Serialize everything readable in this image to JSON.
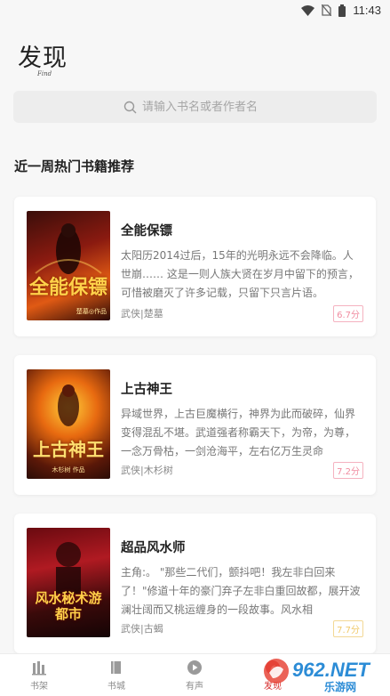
{
  "status": {
    "time": "11:43",
    "icons": [
      "wifi-icon",
      "no-sim-icon",
      "battery-icon"
    ]
  },
  "header": {
    "title": "发现",
    "subtitle": "Find"
  },
  "search": {
    "placeholder": "请输入书名或者作者名",
    "icon": "search-icon"
  },
  "section": {
    "title": "近一周热门书籍推荐"
  },
  "books": [
    {
      "title": "全能保镖",
      "description": "太阳历2014过后，15年的光明永远不会降临。人世崩…… 这是一则人族大贤在岁月中留下的预言，可惜被磨灭了许多记载，只留下只言片语。",
      "meta": "武侠|楚墓",
      "score": "6.7分",
      "score_color": "#f08ca0",
      "cover": {
        "text": "全能保镖",
        "author_line": "楚墓◎作品"
      }
    },
    {
      "title": "上古神王",
      "description": "异域世界，上古巨魔横行，神界为此而破碎，仙界变得混乱不堪。武道强者称霸天下，为帝，为尊，一念万骨枯，一剑沧海平，左右亿万生灵命",
      "meta": "武侠|木杉树",
      "score": "7.2分",
      "score_color": "#f08ca0",
      "cover": {
        "text": "上古神王",
        "author_line": "木杉树 作品"
      }
    },
    {
      "title": "超品风水师",
      "description": "主角:。 \"那些二代们，颤抖吧！我左非白回来了！\"修道十年的豪门弃子左非白重回故都，展开波澜壮阔而又桃运缠身的一段故事。风水相",
      "meta": "武侠|古蝎",
      "score": "7.7分",
      "score_color": "#f0c96a",
      "cover": {
        "text": "风水秘术游都市"
      }
    }
  ],
  "tabs": [
    {
      "label": "书架",
      "icon": "bookshelf-icon"
    },
    {
      "label": "书城",
      "icon": "book-city-icon"
    },
    {
      "label": "有声",
      "icon": "play-icon"
    },
    {
      "label": "发现",
      "icon": "discover-icon",
      "active": true
    }
  ],
  "watermark": {
    "brand": "962.NET",
    "sub": "乐游网"
  },
  "colors": {
    "accent": "#d62d2d",
    "background": "#f7f7f7",
    "card": "#ffffff"
  }
}
